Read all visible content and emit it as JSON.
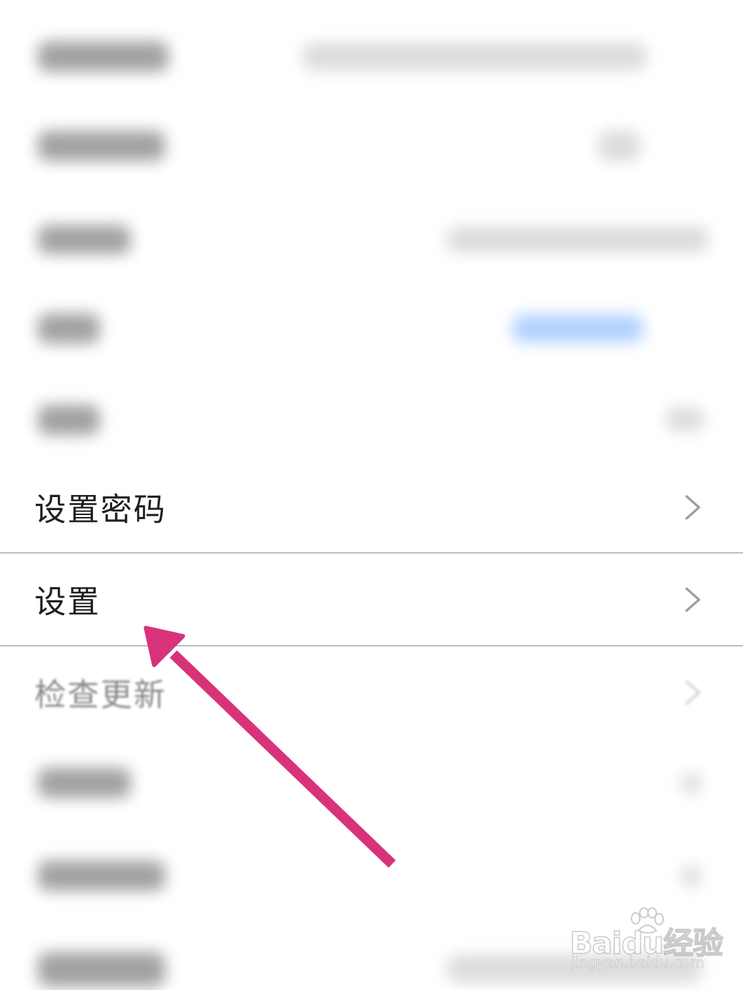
{
  "menu": {
    "set_password": "设置密码",
    "settings": "设置",
    "check_update": "检查更新"
  },
  "watermark": {
    "brand": "Baidu经验",
    "url": "jingyan.baidu.com"
  },
  "colors": {
    "arrow": "#d8337a",
    "divider": "#bdbdbd",
    "text": "#1f1f1f",
    "chevron": "#9e9e9e"
  },
  "icons": {
    "chevron": "chevron-right-icon",
    "pointer": "arrow-pointer-icon"
  }
}
